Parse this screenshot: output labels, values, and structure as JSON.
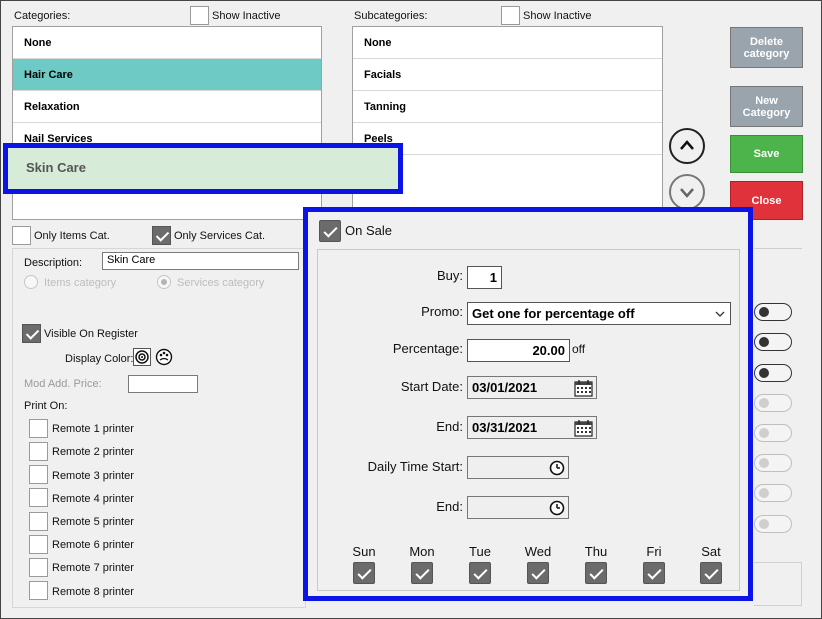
{
  "categories": {
    "label": "Categories:",
    "show_inactive": "Show Inactive",
    "items": [
      "None",
      "Hair Care",
      "Relaxation",
      "Nail Services"
    ],
    "selected_color": "#6ecac4"
  },
  "subcategories": {
    "label": "Subcategories:",
    "show_inactive": "Show Inactive",
    "items": [
      "None",
      "Facials",
      "Tanning",
      "Peels"
    ]
  },
  "buttons": {
    "delete": "Delete category",
    "new": "New Category",
    "save": "Save",
    "close": "Close"
  },
  "filters": {
    "only_items": "Only Items Cat.",
    "only_services": "Only Services Cat."
  },
  "form": {
    "description_label": "Description:",
    "description_value": "Skin Care",
    "items_category": "Items category",
    "services_category": "Services category",
    "visible_on_register": "Visible On Register",
    "display_color": "Display Color:",
    "mod_add_price": "Mod Add. Price:",
    "mod_add_price_value": "",
    "print_on": "Print On:",
    "printers": [
      "Remote 1 printer",
      "Remote 2 printer",
      "Remote 3 printer",
      "Remote 4 printer",
      "Remote 5 printer",
      "Remote 6 printer",
      "Remote 7 printer",
      "Remote 8 printer"
    ]
  },
  "highlight": {
    "text": "Skin Care",
    "border_color": "#0a14e6"
  },
  "on_sale": {
    "title": "On Sale",
    "buy_label": "Buy:",
    "buy_value": "1",
    "promo_label": "Promo:",
    "promo_value": "Get one for percentage off",
    "percentage_label": "Percentage:",
    "percentage_value": "20.00",
    "percentage_suffix": "off",
    "start_date_label": "Start Date:",
    "start_date_value": "03/01/2021",
    "end_label": "End:",
    "end_date_value": "03/31/2021",
    "daily_start_label": "Daily Time Start:",
    "daily_start_value": "",
    "daily_end_label": "End:",
    "daily_end_value": "",
    "days": [
      "Sun",
      "Mon",
      "Tue",
      "Wed",
      "Thu",
      "Fri",
      "Sat"
    ]
  },
  "icons": {
    "calendar": "calendar-icon",
    "clock": "clock-icon",
    "dropdown": "chevron-down-icon",
    "up": "arrow-up-icon",
    "down": "arrow-down-icon"
  },
  "colors": {
    "save": "#4cb44a",
    "close": "#e0323a",
    "gray_button": "#9aa4ad",
    "checked": "#6b6b6b"
  }
}
